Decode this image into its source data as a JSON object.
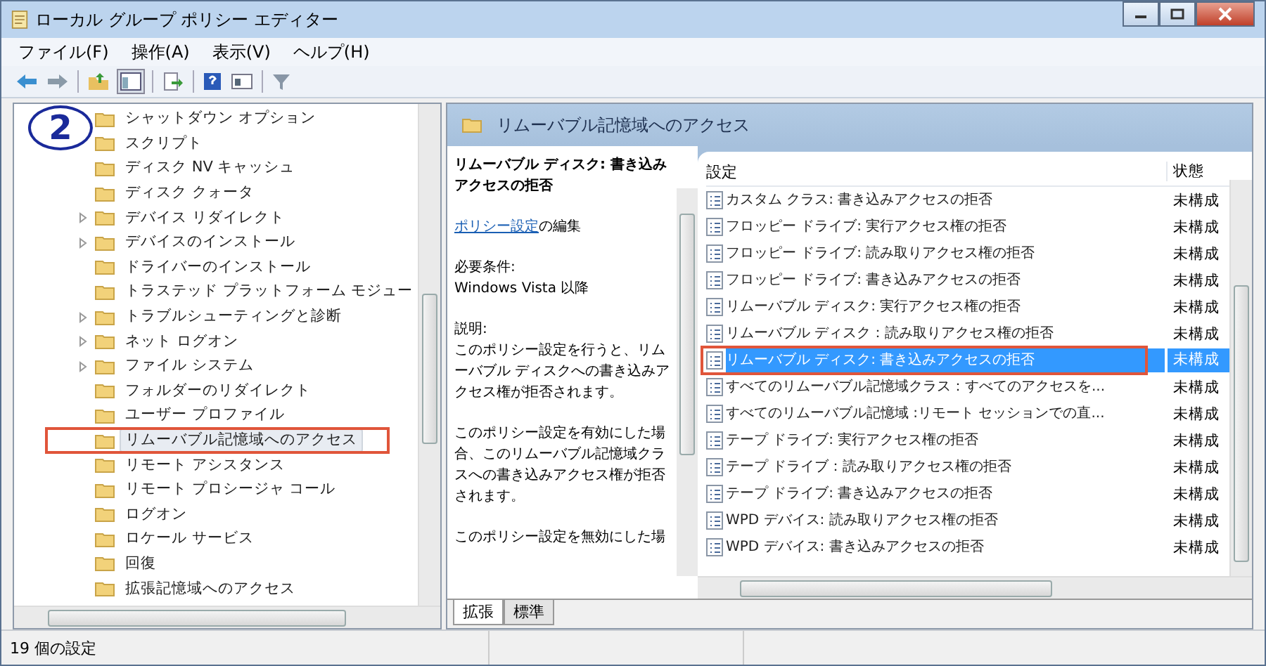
{
  "window": {
    "title": "ローカル グループ ポリシー エディター"
  },
  "menu": [
    "ファイル(F)",
    "操作(A)",
    "表示(V)",
    "ヘルプ(H)"
  ],
  "annotation": {
    "label": "2"
  },
  "tree": {
    "items": [
      {
        "label": "シャットダウン オプション",
        "expandable": false,
        "selected": false,
        "annotated": false
      },
      {
        "label": "スクリプト",
        "expandable": false,
        "selected": false,
        "annotated": false
      },
      {
        "label": "ディスク NV キャッシュ",
        "expandable": false,
        "selected": false,
        "annotated": false
      },
      {
        "label": "ディスク クォータ",
        "expandable": false,
        "selected": false,
        "annotated": false
      },
      {
        "label": "デバイス リダイレクト",
        "expandable": true,
        "selected": false,
        "annotated": false
      },
      {
        "label": "デバイスのインストール",
        "expandable": true,
        "selected": false,
        "annotated": false
      },
      {
        "label": "ドライバーのインストール",
        "expandable": false,
        "selected": false,
        "annotated": false
      },
      {
        "label": "トラステッド プラットフォーム モジュー",
        "expandable": false,
        "selected": false,
        "annotated": false
      },
      {
        "label": "トラブルシューティングと診断",
        "expandable": true,
        "selected": false,
        "annotated": false
      },
      {
        "label": "ネット ログオン",
        "expandable": true,
        "selected": false,
        "annotated": false
      },
      {
        "label": "ファイル システム",
        "expandable": true,
        "selected": false,
        "annotated": false
      },
      {
        "label": "フォルダーのリダイレクト",
        "expandable": false,
        "selected": false,
        "annotated": false
      },
      {
        "label": "ユーザー プロファイル",
        "expandable": false,
        "selected": false,
        "annotated": false
      },
      {
        "label": "リムーバブル記憶域へのアクセス",
        "expandable": false,
        "selected": true,
        "annotated": true
      },
      {
        "label": "リモート アシスタンス",
        "expandable": false,
        "selected": false,
        "annotated": false
      },
      {
        "label": "リモート プロシージャ コール",
        "expandable": false,
        "selected": false,
        "annotated": false
      },
      {
        "label": "ログオン",
        "expandable": false,
        "selected": false,
        "annotated": false
      },
      {
        "label": "ロケール サービス",
        "expandable": false,
        "selected": false,
        "annotated": false
      },
      {
        "label": "回復",
        "expandable": false,
        "selected": false,
        "annotated": false
      },
      {
        "label": "拡張記憶域へのアクセス",
        "expandable": false,
        "selected": false,
        "annotated": false
      }
    ]
  },
  "details": {
    "header": "リムーバブル記憶域へのアクセス",
    "title": "リムーバブル ディスク: 書き込みアクセスの拒否",
    "link": "ポリシー設定",
    "link_suffix": "の編集",
    "requirements_label": "必要条件:",
    "requirements": "Windows Vista 以降",
    "description_label": "説明:",
    "paragraphs": [
      "このポリシー設定を行うと、リムーバブル ディスクへの書き込みアクセス権が拒否されます。",
      "このポリシー設定を有効にした場合、このリムーバブル記憶域クラスへの書き込みアクセス権が拒否されます。",
      "このポリシー設定を無効にした場"
    ]
  },
  "list": {
    "columns": [
      "設定",
      "状態"
    ],
    "rows": [
      {
        "name": "カスタム クラス: 書き込みアクセスの拒否",
        "state": "未構成",
        "selected": false,
        "annotated": false
      },
      {
        "name": "フロッピー ドライブ: 実行アクセス権の拒否",
        "state": "未構成",
        "selected": false,
        "annotated": false
      },
      {
        "name": "フロッピー ドライブ: 読み取りアクセス権の拒否",
        "state": "未構成",
        "selected": false,
        "annotated": false
      },
      {
        "name": "フロッピー ドライブ: 書き込みアクセスの拒否",
        "state": "未構成",
        "selected": false,
        "annotated": false
      },
      {
        "name": "リムーバブル ディスク: 実行アクセス権の拒否",
        "state": "未構成",
        "selected": false,
        "annotated": false
      },
      {
        "name": "リムーバブル ディスク：読み取りアクセス権の拒否",
        "state": "未構成",
        "selected": false,
        "annotated": false
      },
      {
        "name": "リムーバブル ディスク: 書き込みアクセスの拒否",
        "state": "未構成",
        "selected": true,
        "annotated": true
      },
      {
        "name": "すべてのリムーバブル記憶域クラス：すべてのアクセスを...",
        "state": "未構成",
        "selected": false,
        "annotated": false
      },
      {
        "name": "すべてのリムーバブル記憶域 :リモート セッションでの直...",
        "state": "未構成",
        "selected": false,
        "annotated": false
      },
      {
        "name": "テープ ドライブ: 実行アクセス権の拒否",
        "state": "未構成",
        "selected": false,
        "annotated": false
      },
      {
        "name": "テープ ドライブ：読み取りアクセス権の拒否",
        "state": "未構成",
        "selected": false,
        "annotated": false
      },
      {
        "name": "テープ ドライブ: 書き込みアクセスの拒否",
        "state": "未構成",
        "selected": false,
        "annotated": false
      },
      {
        "name": "WPD デバイス: 読み取りアクセス権の拒否",
        "state": "未構成",
        "selected": false,
        "annotated": false
      },
      {
        "name": "WPD デバイス: 書き込みアクセスの拒否",
        "state": "未構成",
        "selected": false,
        "annotated": false
      }
    ]
  },
  "tabs": [
    {
      "label": "拡張",
      "selected": true
    },
    {
      "label": "標準",
      "selected": false
    }
  ],
  "status_bar": "19 個の設定"
}
